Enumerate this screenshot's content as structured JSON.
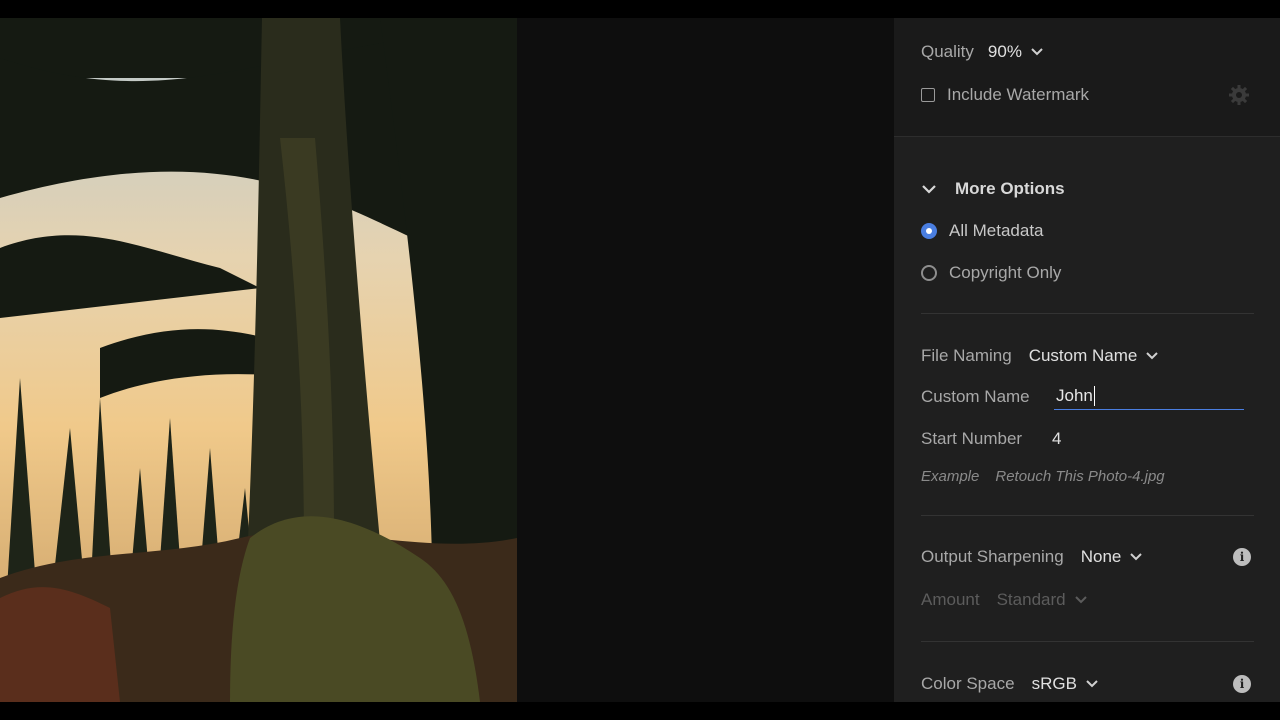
{
  "quality": {
    "label": "Quality",
    "value": "90%"
  },
  "watermark": {
    "label": "Include Watermark",
    "checked": false
  },
  "more_options": {
    "label": "More Options"
  },
  "metadata": {
    "options": [
      {
        "label": "All Metadata",
        "selected": true
      },
      {
        "label": "Copyright Only",
        "selected": false
      }
    ]
  },
  "file_naming": {
    "label": "File Naming",
    "value": "Custom Name"
  },
  "custom_name": {
    "label": "Custom Name",
    "value": "John"
  },
  "start_number": {
    "label": "Start Number",
    "value": "4"
  },
  "example": {
    "label": "Example",
    "value": "Retouch This Photo-4.jpg"
  },
  "output_sharpening": {
    "label": "Output Sharpening",
    "value": "None"
  },
  "amount": {
    "label": "Amount",
    "value": "Standard"
  },
  "color_space": {
    "label": "Color Space",
    "value": "sRGB"
  },
  "colors": {
    "accent": "#4a7ee0",
    "panel_bg": "#1f1f1f",
    "canvas_bg": "#0e0e0e"
  },
  "icons": [
    "settings-gear-icon",
    "chevron-down-icon",
    "info-icon"
  ]
}
